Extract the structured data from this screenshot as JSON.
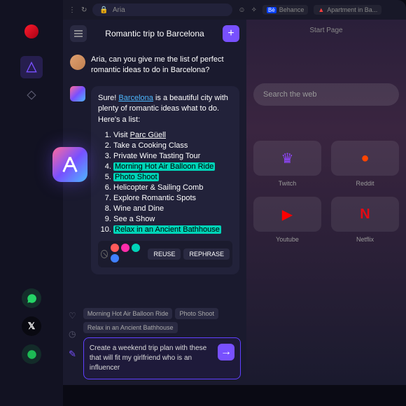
{
  "addr": {
    "title": "Aria"
  },
  "tabs": {
    "behance": "Behance",
    "apt": "Apartment in Ba...",
    "start": "Start Page"
  },
  "sidebar": {
    "whatsapp": "whatsapp",
    "x": "𝕏",
    "spotify": "spotify"
  },
  "chat": {
    "title": "Romantic trip to Barcelona",
    "user_msg": "Aria, can you give me the list of perfect romantic ideas to do in Barcelona?",
    "reply_prefix": "Sure! ",
    "reply_link": "Barcelona",
    "reply_suffix": " is a beautiful city with plenty of romantic ideas what to do. Here's a list:",
    "items": [
      {
        "pre": "Visit ",
        "link": "Parc Güell",
        "hl": false
      },
      {
        "text": "Take a Cooking Class",
        "hl": false
      },
      {
        "text": "Private Wine Tasting Tour",
        "hl": false
      },
      {
        "text": "Morning Hot Air Balloon Ride",
        "hl": true
      },
      {
        "text": "Photo Shoot",
        "hl": true
      },
      {
        "text": "Helicopter & Sailing Comb",
        "hl": false
      },
      {
        "text": "Explore Romantic Spots",
        "hl": false
      },
      {
        "text": "Wine and Dine",
        "hl": false
      },
      {
        "text": "See a Show",
        "hl": false
      },
      {
        "text": "Relax in an Ancient Bathhouse",
        "hl": true
      }
    ],
    "actions": {
      "reuse": "REUSE",
      "rephrase": "REPHRASE"
    },
    "colors": [
      "#ff5a5a",
      "#ff2daa",
      "#00d4b8",
      "#4080ff"
    ],
    "chips": [
      "Morning Hot Air Balloon Ride",
      "Photo Shoot",
      "Relax in an Ancient Bathhouse"
    ],
    "compose": "Create a weekend trip plan with these that will fit my girlfriend who is an influencer"
  },
  "start": {
    "search": "Search the web",
    "tiles": [
      {
        "label": "Twitch",
        "class": "twitch",
        "glyph": "♛"
      },
      {
        "label": "Reddit",
        "class": "reddit",
        "glyph": "●"
      },
      {
        "label": "Youtube",
        "class": "youtube",
        "glyph": "▶"
      },
      {
        "label": "Netflix",
        "class": "netflix",
        "glyph": "N"
      }
    ]
  }
}
